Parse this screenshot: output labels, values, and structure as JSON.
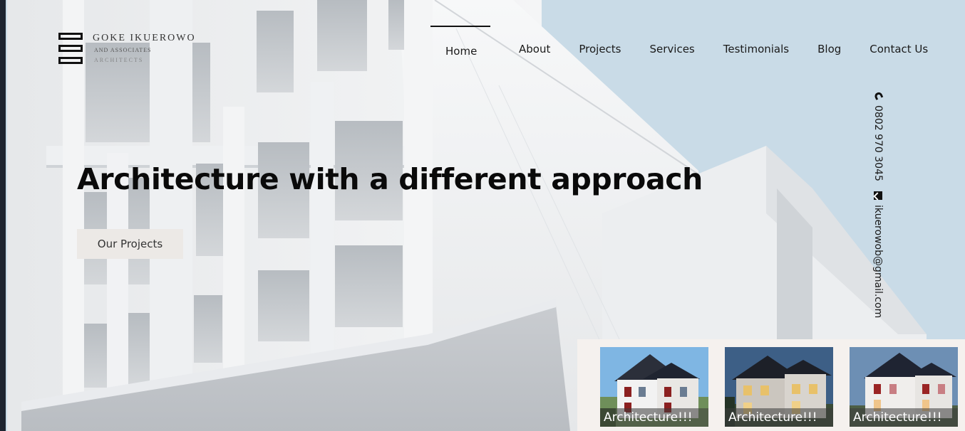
{
  "logo": {
    "name": "GOKE IKUEROWO",
    "subtitle": "AND ASSOCIATES",
    "tagline": "ARCHITECTS"
  },
  "nav": {
    "items": [
      {
        "label": "Home",
        "active": true
      },
      {
        "label": "About"
      },
      {
        "label": "Projects"
      },
      {
        "label": "Services"
      },
      {
        "label": "Testimonials"
      },
      {
        "label": "Blog"
      },
      {
        "label": "Contact Us"
      }
    ]
  },
  "contact": {
    "phone": "0802 970 3045",
    "email": "ikuerowob@gmail.com",
    "phone_icon": "phone-icon",
    "email_icon": "mail-icon"
  },
  "hero": {
    "headline": "Architecture with a different approach",
    "cta_label": "Our Projects"
  },
  "cards": [
    {
      "label": "Architecture!!!"
    },
    {
      "label": "Architecture!!!"
    },
    {
      "label": "Architecture!!!"
    }
  ],
  "colors": {
    "sky": "#c9dbe7",
    "panel": "#f5f1ee",
    "cta_bg": "#ece9e6",
    "text_dark": "#0a0a0a"
  }
}
